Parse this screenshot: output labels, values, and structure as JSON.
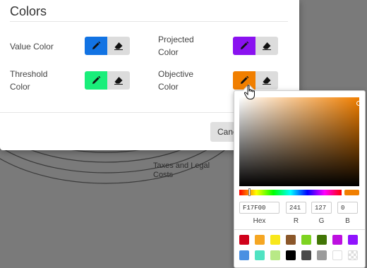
{
  "modal": {
    "title": "Colors",
    "cancel_label": "Cancel"
  },
  "background": {
    "label": "Taxes and Legal Costs"
  },
  "color_rows": [
    {
      "label": "Value Color",
      "color": "#1273E3"
    },
    {
      "label": "Projected Color",
      "color": "#8A12F0"
    },
    {
      "label": "Threshold Color",
      "color": "#19EE7A"
    },
    {
      "label": "Objective Color",
      "color": "#F17F00"
    }
  ],
  "icons": {
    "edit": "pencil-icon",
    "erase": "eraser-icon",
    "cursor": "hand-pointer-icon"
  },
  "picker": {
    "current_color": "#F17F00",
    "hue_fraction": 0.09,
    "hex": "F17F00",
    "r": "241",
    "g": "127",
    "b": "0",
    "labels": {
      "hex": "Hex",
      "r": "R",
      "g": "G",
      "b": "B"
    },
    "presets_row1": [
      "#D0021B",
      "#F5A623",
      "#F8E71C",
      "#8B572A",
      "#7ED321",
      "#417505",
      "#BD10E0",
      "#9013FE"
    ],
    "presets_row2": [
      "#4A90E2",
      "#50E3C2",
      "#B8E986",
      "#000000",
      "#4A4A4A",
      "#9B9B9B",
      "#FFFFFF",
      "transparent"
    ]
  }
}
